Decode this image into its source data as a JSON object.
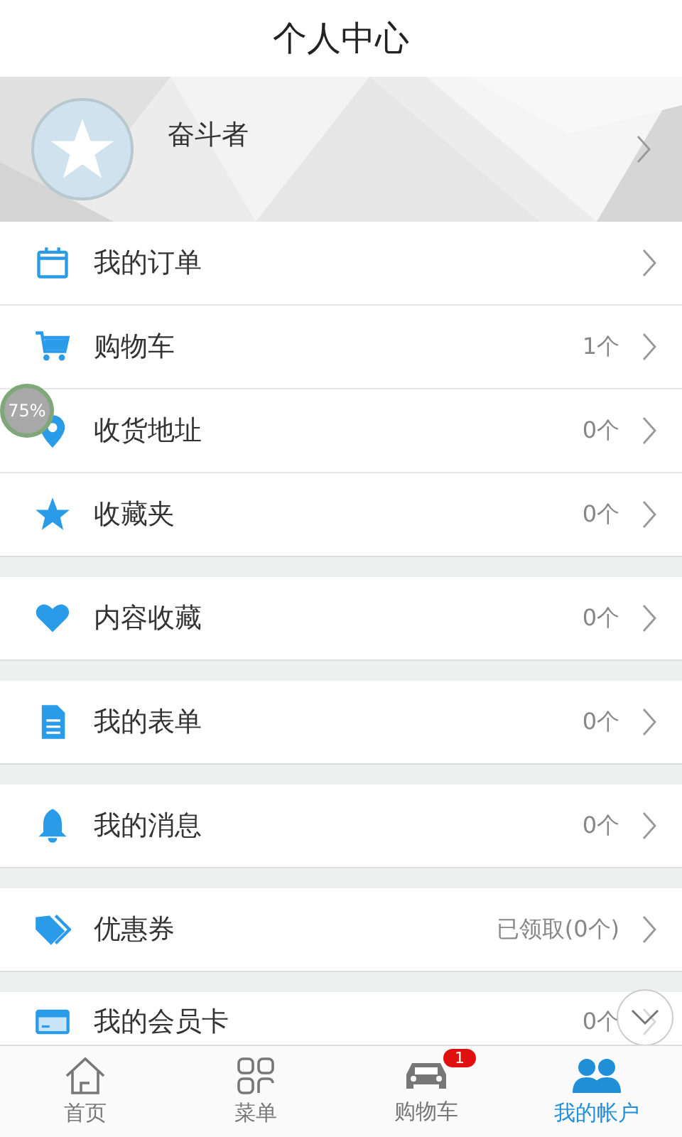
{
  "header": {
    "title": "个人中心"
  },
  "profile": {
    "name": "奋斗者"
  },
  "groups": [
    {
      "rows": [
        {
          "label": "我的订单"
        },
        {
          "label": "购物车",
          "count": "1个"
        },
        {
          "label": "收货地址",
          "count": "0个"
        },
        {
          "label": "收藏夹",
          "count": "0个"
        }
      ]
    },
    {
      "rows": [
        {
          "label": "内容收藏",
          "count": "0个"
        }
      ]
    },
    {
      "rows": [
        {
          "label": "我的表单",
          "count": "0个"
        }
      ]
    },
    {
      "rows": [
        {
          "label": "我的消息",
          "count": "0个"
        }
      ]
    },
    {
      "rows": [
        {
          "label": "优惠券",
          "count": "已领取(0个)"
        }
      ]
    },
    {
      "rows": [
        {
          "label": "我的会员卡",
          "count": "0个"
        }
      ]
    }
  ],
  "floating_badge": {
    "text": "75%"
  },
  "tabbar": [
    {
      "label": "首页",
      "selected": false
    },
    {
      "label": "菜单",
      "selected": false
    },
    {
      "label": "购物车",
      "selected": false,
      "badge": "1"
    },
    {
      "label": "我的帐户",
      "selected": true
    }
  ]
}
